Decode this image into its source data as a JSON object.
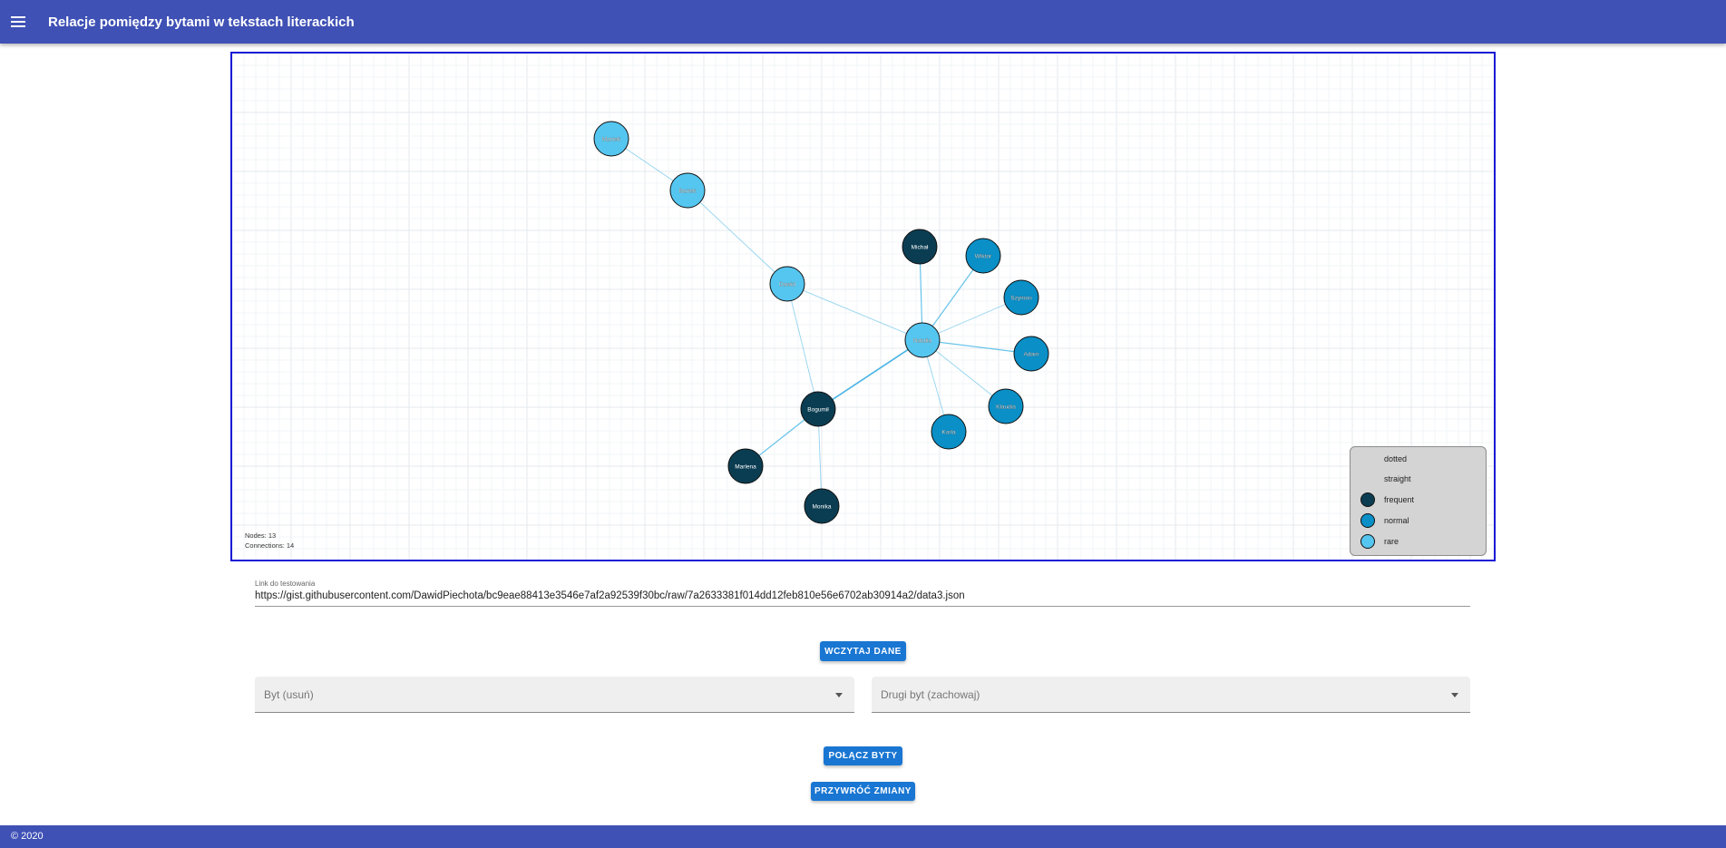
{
  "app": {
    "title": "Relacje pomiędzy bytami w tekstach literackich",
    "menu_icon": "menu-icon"
  },
  "graph": {
    "stats": {
      "nodes": "Nodes: 13",
      "connections": "Connections: 14"
    },
    "colors": {
      "frequent": "#0b3d52",
      "normal": "#0a8fc7",
      "rare": "#55c6f0",
      "link": "#4cb8e6",
      "grid": "#eef2f5"
    },
    "nodes": [
      {
        "id": "maciek",
        "label": "Maciek",
        "type": "rare"
      },
      {
        "id": "bartek",
        "label": "Bartek",
        "type": "rare"
      },
      {
        "id": "dawid",
        "label": "Dawid",
        "type": "rare"
      },
      {
        "id": "natalia",
        "label": "Natalia",
        "type": "rare"
      },
      {
        "id": "michal",
        "label": "Michał",
        "type": "frequent"
      },
      {
        "id": "bogumil",
        "label": "Bogumił",
        "type": "frequent"
      },
      {
        "id": "marlena",
        "label": "Marlena",
        "type": "frequent"
      },
      {
        "id": "monika",
        "label": "Monika",
        "type": "frequent"
      },
      {
        "id": "wiktor",
        "label": "Wiktor",
        "type": "normal"
      },
      {
        "id": "szymon",
        "label": "Szymon",
        "type": "normal"
      },
      {
        "id": "adam",
        "label": "Adam",
        "type": "normal"
      },
      {
        "id": "klaudia",
        "label": "Klaudia",
        "type": "normal"
      },
      {
        "id": "karla",
        "label": "Karla",
        "type": "normal"
      }
    ],
    "links": [
      {
        "source": "maciek",
        "target": "bartek",
        "strength": "rare"
      },
      {
        "source": "bartek",
        "target": "dawid",
        "strength": "rare"
      },
      {
        "source": "dawid",
        "target": "natalia",
        "strength": "rare"
      },
      {
        "source": "dawid",
        "target": "bogumil",
        "strength": "rare"
      },
      {
        "source": "natalia",
        "target": "michal",
        "strength": "normal"
      },
      {
        "source": "natalia",
        "target": "wiktor",
        "strength": "normal"
      },
      {
        "source": "natalia",
        "target": "szymon",
        "strength": "rare"
      },
      {
        "source": "natalia",
        "target": "adam",
        "strength": "normal"
      },
      {
        "source": "natalia",
        "target": "klaudia",
        "strength": "rare"
      },
      {
        "source": "natalia",
        "target": "karla",
        "strength": "rare"
      },
      {
        "source": "natalia",
        "target": "bogumil",
        "strength": "frequent"
      },
      {
        "source": "bogumil",
        "target": "marlena",
        "strength": "normal"
      },
      {
        "source": "bogumil",
        "target": "monika",
        "strength": "rare"
      },
      {
        "source": "bogumil",
        "target": "natalia",
        "strength": "normal"
      }
    ],
    "legend": {
      "items": [
        {
          "label": "dotted",
          "color": ""
        },
        {
          "label": "straight",
          "color": ""
        },
        {
          "label": "frequent",
          "color": "#0b3d52"
        },
        {
          "label": "normal",
          "color": "#0a8fc7"
        },
        {
          "label": "rare",
          "color": "#55c6f0"
        }
      ]
    }
  },
  "form": {
    "link_label": "Link do testowania",
    "link_value": "https://gist.githubusercontent.com/DawidPiechota/bc9eae88413e3546e7af2a92539f30bc/raw/7a2633381f014dd12feb810e56e6702ab30914a2/data3.json",
    "load_button": "Wczytaj dane",
    "select_remove_label": "Byt (usuń)",
    "select_keep_label": "Drugi byt (zachowaj)",
    "merge_button": "Połącz byty",
    "revert_button": "Przywróć zmiany"
  },
  "footer": {
    "text": "© 2020"
  }
}
